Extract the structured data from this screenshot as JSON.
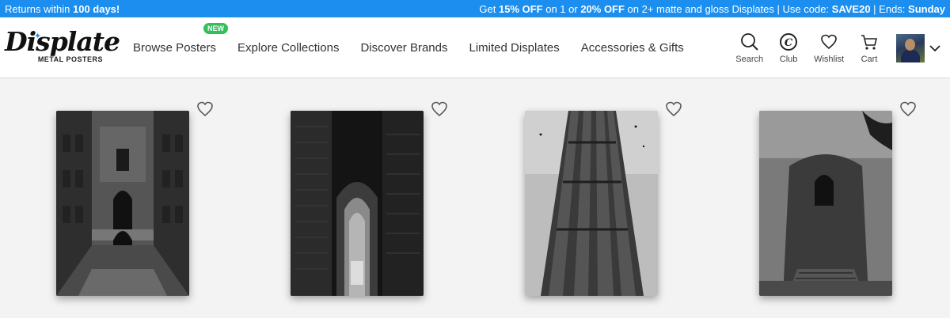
{
  "promo": {
    "left_prefix": "Returns within ",
    "left_bold": "100 days!",
    "right_1": "Get ",
    "right_2": "15% OFF",
    "right_3": " on 1 or ",
    "right_4": "20% OFF",
    "right_5": " on 2+ matte and gloss Displates | Use code: ",
    "right_6": "SAVE20",
    "right_7": " | Ends: ",
    "right_8": "Sunday",
    "bg_color": "#1b8ef0"
  },
  "header": {
    "logo_word": "Displate",
    "logo_sub": "METAL POSTERS",
    "nav": [
      {
        "label": "Browse Posters",
        "badge": "NEW"
      },
      {
        "label": "Explore Collections"
      },
      {
        "label": "Discover Brands"
      },
      {
        "label": "Limited Displates"
      },
      {
        "label": "Accessories & Gifts"
      }
    ],
    "actions": [
      {
        "label": "Search",
        "icon": "search-icon"
      },
      {
        "label": "Club",
        "icon": "club-icon"
      },
      {
        "label": "Wishlist",
        "icon": "heart-icon"
      },
      {
        "label": "Cart",
        "icon": "cart-icon"
      }
    ],
    "badge_color": "#33c05a"
  },
  "products": [
    {
      "subject": "stepwell",
      "icon": "heart-icon"
    },
    {
      "subject": "arched doorway",
      "icon": "heart-icon"
    },
    {
      "subject": "fluted tower",
      "icon": "heart-icon"
    },
    {
      "subject": "ruined tower",
      "icon": "heart-icon"
    }
  ]
}
